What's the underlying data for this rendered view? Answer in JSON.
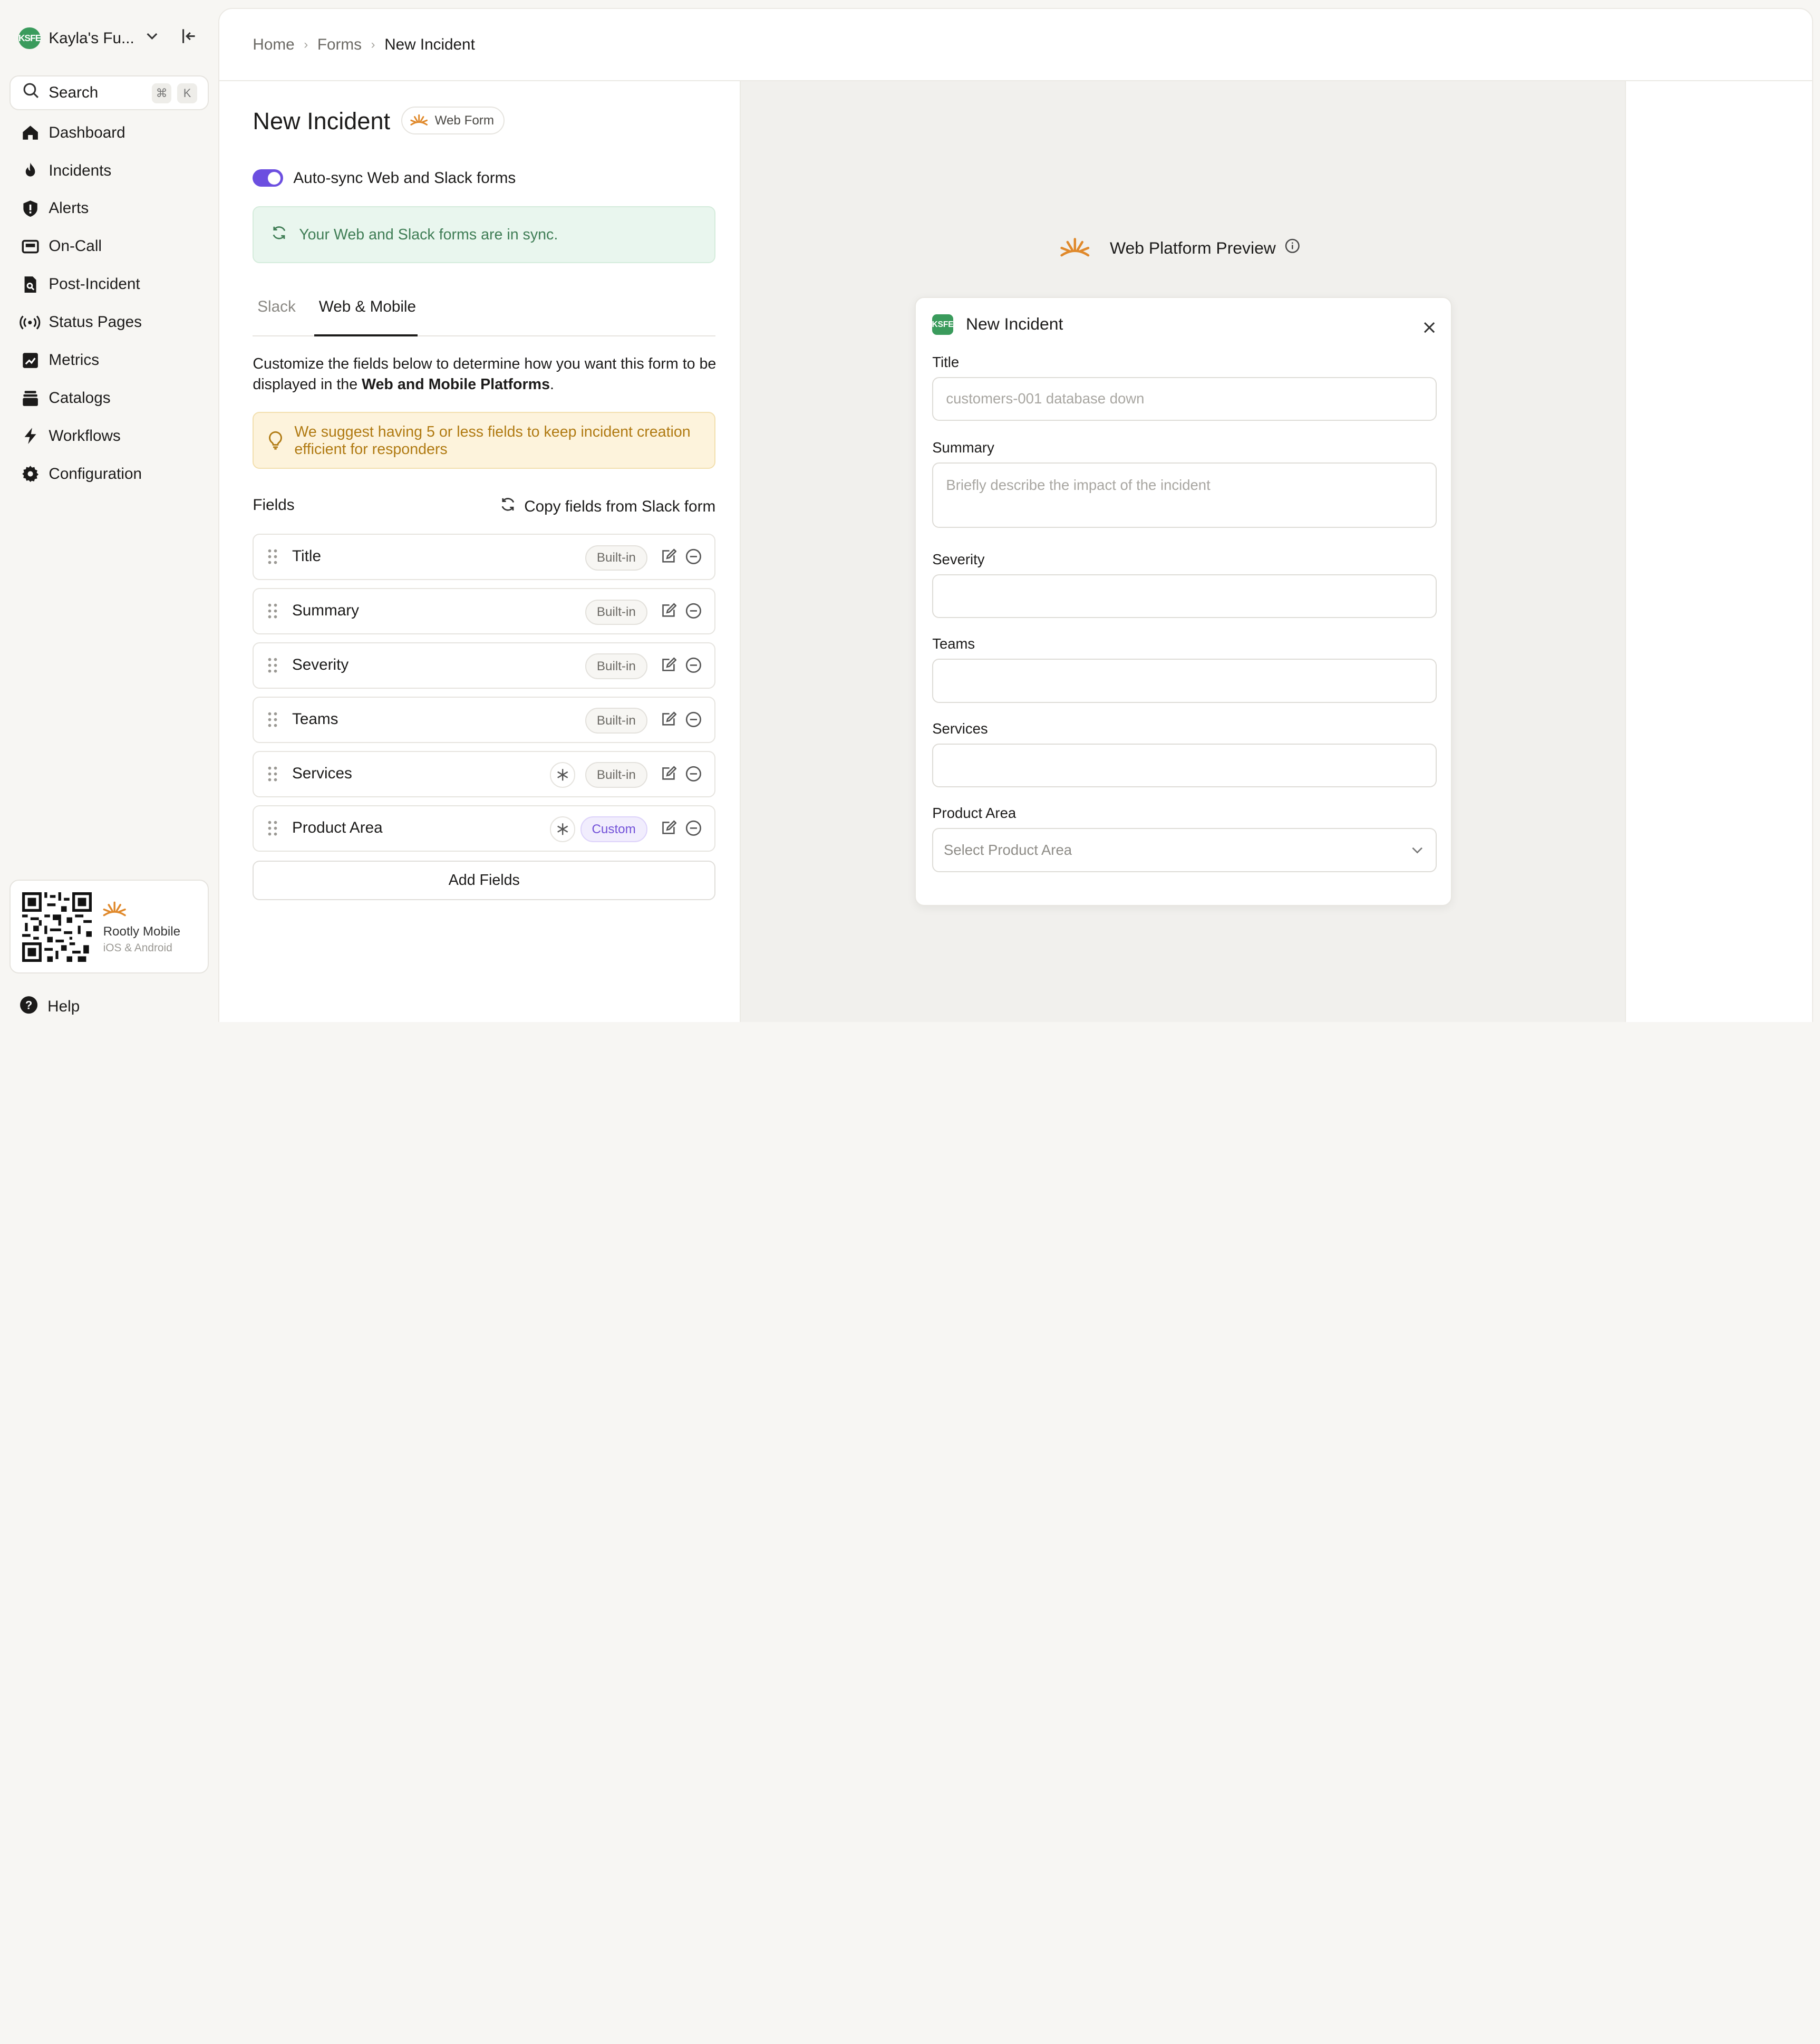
{
  "workspace": {
    "logo_text": "KSFE",
    "name": "Kayla's Fu..."
  },
  "search": {
    "label": "Search",
    "kbd1": "⌘",
    "kbd2": "K"
  },
  "nav": [
    {
      "label": "Dashboard",
      "icon": "home-icon"
    },
    {
      "label": "Incidents",
      "icon": "flame-icon"
    },
    {
      "label": "Alerts",
      "icon": "shield-icon"
    },
    {
      "label": "On-Call",
      "icon": "pager-icon"
    },
    {
      "label": "Post-Incident",
      "icon": "document-search-icon"
    },
    {
      "label": "Status Pages",
      "icon": "broadcast-icon"
    },
    {
      "label": "Metrics",
      "icon": "chart-icon"
    },
    {
      "label": "Catalogs",
      "icon": "catalog-icon"
    },
    {
      "label": "Workflows",
      "icon": "bolt-icon"
    },
    {
      "label": "Configuration",
      "icon": "gear-icon"
    }
  ],
  "mobile": {
    "title": "Rootly Mobile",
    "subtitle": "iOS & Android"
  },
  "help": {
    "label": "Help"
  },
  "breadcrumb": {
    "home": "Home",
    "forms": "Forms",
    "current": "New Incident"
  },
  "editor": {
    "title": "New Incident",
    "badge": "Web Form",
    "toggle_label": "Auto-sync Web and Slack forms",
    "sync_message": "Your Web and Slack forms are in sync.",
    "tabs": [
      "Slack",
      "Web & Mobile"
    ],
    "description_prefix": "Customize the fields below to determine how you want this form to be displayed in the ",
    "description_bold": "Web and Mobile Platforms",
    "description_suffix": ".",
    "warning": "We suggest having 5 or less fields to keep incident creation efficient for responders",
    "fields_label": "Fields",
    "copy_label": "Copy fields from Slack form",
    "fields": [
      {
        "name": "Title",
        "tag": "Built-in",
        "required_icon": false
      },
      {
        "name": "Summary",
        "tag": "Built-in",
        "required_icon": false
      },
      {
        "name": "Severity",
        "tag": "Built-in",
        "required_icon": false
      },
      {
        "name": "Teams",
        "tag": "Built-in",
        "required_icon": false
      },
      {
        "name": "Services",
        "tag": "Built-in",
        "required_icon": true
      },
      {
        "name": "Product Area",
        "tag": "Custom",
        "required_icon": true
      }
    ],
    "add_fields": "Add Fields"
  },
  "preview": {
    "heading": "Web Platform Preview",
    "modal_logo": "KSFE",
    "modal_title": "New Incident",
    "title_label": "Title",
    "title_placeholder": "customers-001 database down",
    "summary_label": "Summary",
    "summary_placeholder": "Briefly describe the impact of the incident",
    "severity_label": "Severity",
    "teams_label": "Teams",
    "services_label": "Services",
    "product_label": "Product Area",
    "product_placeholder": "Select Product Area"
  },
  "colors": {
    "accent": "#6c4fe0",
    "brand_orange": "#e0892b",
    "success_bg": "#e9f6ee",
    "warning_bg": "#fdf3dc"
  }
}
